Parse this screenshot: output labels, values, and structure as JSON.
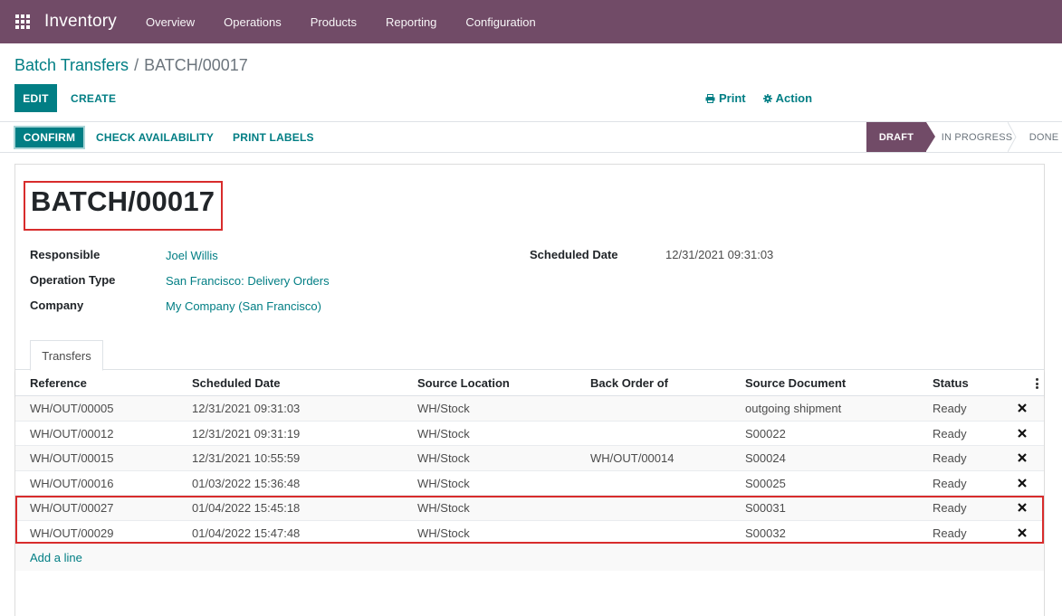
{
  "navbar": {
    "app_name": "Inventory",
    "menu": [
      "Overview",
      "Operations",
      "Products",
      "Reporting",
      "Configuration"
    ]
  },
  "breadcrumb": {
    "parent": "Batch Transfers",
    "separator": "/",
    "current": "BATCH/00017"
  },
  "control_panel": {
    "edit_label": "EDIT",
    "create_label": "CREATE",
    "print_label": "Print",
    "action_label": "Action"
  },
  "statusbar": {
    "confirm_label": "CONFIRM",
    "check_availability_label": "CHECK AVAILABILITY",
    "print_labels_label": "PRINT LABELS",
    "stages": [
      "DRAFT",
      "IN PROGRESS",
      "DONE"
    ],
    "active_stage": "DRAFT"
  },
  "form": {
    "title": "BATCH/00017",
    "responsible_label": "Responsible",
    "responsible_value": "Joel Willis",
    "operation_type_label": "Operation Type",
    "operation_type_value": "San Francisco: Delivery Orders",
    "company_label": "Company",
    "company_value": "My Company (San Francisco)",
    "scheduled_date_label": "Scheduled Date",
    "scheduled_date_value": "12/31/2021 09:31:03"
  },
  "tabs": {
    "transfers_label": "Transfers"
  },
  "table": {
    "headers": [
      "Reference",
      "Scheduled Date",
      "Source Location",
      "Back Order of",
      "Source Document",
      "Status"
    ],
    "rows": [
      [
        "WH/OUT/00005",
        "12/31/2021 09:31:03",
        "WH/Stock",
        "",
        "outgoing shipment",
        "Ready"
      ],
      [
        "WH/OUT/00012",
        "12/31/2021 09:31:19",
        "WH/Stock",
        "",
        "S00022",
        "Ready"
      ],
      [
        "WH/OUT/00015",
        "12/31/2021 10:55:59",
        "WH/Stock",
        "WH/OUT/00014",
        "S00024",
        "Ready"
      ],
      [
        "WH/OUT/00016",
        "01/03/2022 15:36:48",
        "WH/Stock",
        "",
        "S00025",
        "Ready"
      ],
      [
        "WH/OUT/00027",
        "01/04/2022 15:45:18",
        "WH/Stock",
        "",
        "S00031",
        "Ready"
      ],
      [
        "WH/OUT/00029",
        "01/04/2022 15:47:48",
        "WH/Stock",
        "",
        "S00032",
        "Ready"
      ]
    ],
    "add_line_label": "Add a line"
  },
  "colors": {
    "brand": "#714b67",
    "accent": "#017e84",
    "highlight": "#d82c2c"
  }
}
